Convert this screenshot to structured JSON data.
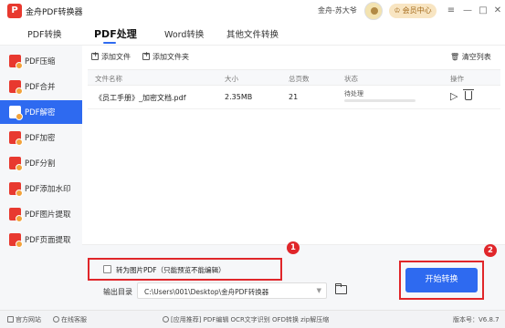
{
  "app": {
    "title": "金舟PDF转换器",
    "logo_text": "P"
  },
  "header": {
    "user_name": "金舟-苏大爷",
    "vip_label": "会员中心",
    "vip_icon": "♔"
  },
  "window_controls": [
    {
      "name": "menu-icon",
      "glyph": "≡"
    },
    {
      "name": "minimize-icon",
      "glyph": "—"
    },
    {
      "name": "maximize-icon",
      "glyph": "□"
    },
    {
      "name": "close-icon",
      "glyph": "✕"
    }
  ],
  "nav": {
    "tabs": [
      {
        "label": "PDF转换"
      },
      {
        "label": "PDF处理"
      },
      {
        "label": "Word转换"
      },
      {
        "label": "其他文件转换"
      }
    ],
    "active_index": 1
  },
  "sidebar": {
    "items": [
      {
        "label": "PDF压缩"
      },
      {
        "label": "PDF合并"
      },
      {
        "label": "PDF解密"
      },
      {
        "label": "PDF加密"
      },
      {
        "label": "PDF分割"
      },
      {
        "label": "PDF添加水印"
      },
      {
        "label": "PDF图片提取"
      },
      {
        "label": "PDF页面提取"
      }
    ],
    "active_index": 2
  },
  "toolbar": {
    "add_file": "添加文件",
    "add_folder": "添加文件夹",
    "clear_list": "清空列表",
    "clear_icon": "🗑"
  },
  "table": {
    "headers": {
      "name": "文件名称",
      "size": "大小",
      "pages": "总页数",
      "status": "状态",
      "action": "操作"
    },
    "rows": [
      {
        "name": "《员工手册》_加密文档.pdf",
        "size": "2.35MB",
        "pages": "21",
        "status": "待处理",
        "progress": 0.0
      }
    ],
    "play_glyph": "▷"
  },
  "options": {
    "convert_to_image_label": "转为图片PDF（只能预览不能编辑）",
    "convert_to_image_checked": false,
    "output_dir_label": "输出目录",
    "output_dir_value": "C:\\Users\\001\\Desktop\\金舟PDF转换器",
    "dropdown_glyph": "▼"
  },
  "start_button": "开始转换",
  "annotations": {
    "badge_1": "1",
    "badge_2": "2",
    "highlight_color": "#e0262a"
  },
  "footer": {
    "website": "官方网站",
    "support": "在线客服",
    "recommend": "[应用推荐]  PDF编辑  OCR文字识别  OFD转换  zip解压缩",
    "version": "版本号：V6.8.7"
  },
  "colors": {
    "accent": "#2e6af0",
    "brand": "#e8392f",
    "vip_bg": "#f8e5c2"
  }
}
